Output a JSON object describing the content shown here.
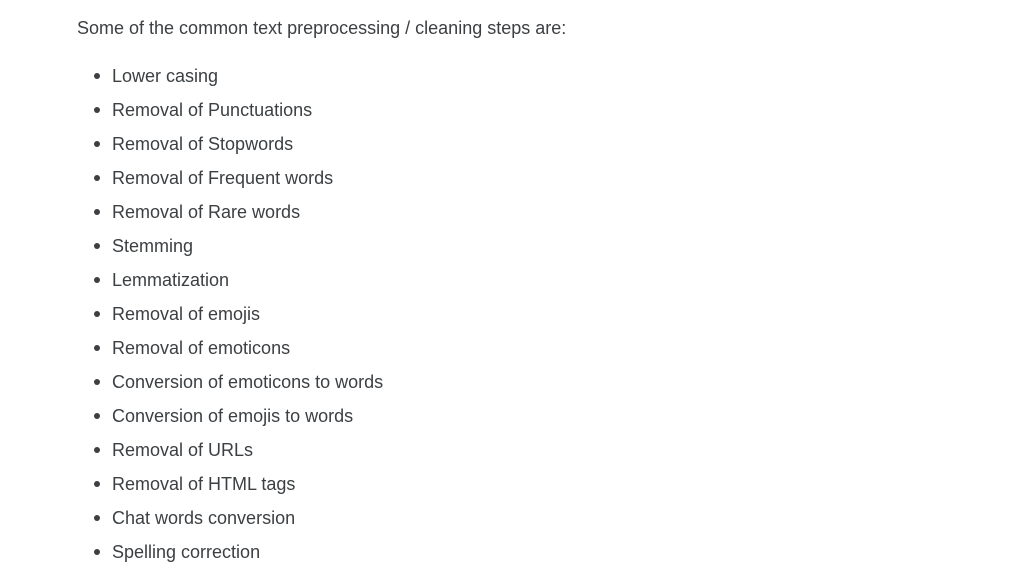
{
  "article": {
    "intro": "Some of the common text preprocessing / cleaning steps are:",
    "steps": [
      "Lower casing",
      "Removal of Punctuations",
      "Removal of Stopwords",
      "Removal of Frequent words",
      "Removal of Rare words",
      "Stemming",
      "Lemmatization",
      "Removal of emojis",
      "Removal of emoticons",
      "Conversion of emoticons to words",
      "Conversion of emojis to words",
      "Removal of URLs",
      "Removal of HTML tags",
      "Chat words conversion",
      "Spelling correction"
    ]
  }
}
